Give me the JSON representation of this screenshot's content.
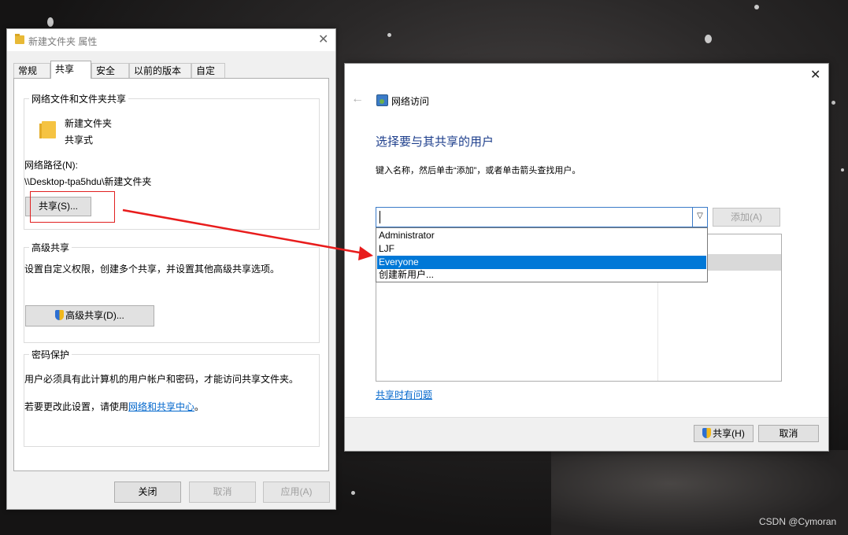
{
  "properties_dialog": {
    "title": "新建文件夹 属性",
    "tabs": [
      "常规",
      "共享",
      "安全",
      "以前的版本",
      "自定义"
    ],
    "active_tab": "共享",
    "network_sharing": {
      "group_title": "网络文件和文件夹共享",
      "folder_name": "新建文件夹",
      "share_state": "共享式",
      "path_label": "网络路径(N):",
      "path_value": "\\\\Desktop-tpa5hdu\\新建文件夹",
      "share_button": "共享(S)..."
    },
    "advanced_sharing": {
      "group_title": "高级共享",
      "description": "设置自定义权限，创建多个共享，并设置其他高级共享选项。",
      "button": "高级共享(D)..."
    },
    "password_protection": {
      "group_title": "密码保护",
      "description": "用户必须具有此计算机的用户帐户和密码，才能访问共享文件夹。",
      "change_prefix": "若要更改此设置，请使用",
      "change_link": "网络和共享中心",
      "change_suffix": "。"
    },
    "buttons": {
      "close": "关闭",
      "cancel": "取消",
      "apply": "应用(A)"
    }
  },
  "network_dialog": {
    "title": "网络访问",
    "heading": "选择要与其共享的用户",
    "instruction": "键入名称，然后单击“添加”，或者单击箭头查找用户。",
    "input_value": "",
    "add_button": "添加(A)",
    "dropdown_options": [
      "Administrator",
      "LJF",
      "Everyone",
      "创建新用户..."
    ],
    "selected_option": "Everyone",
    "help_link": "共享时有问题",
    "share_button": "共享(H)",
    "cancel_button": "取消"
  },
  "watermark": "CSDN @Cymoran"
}
